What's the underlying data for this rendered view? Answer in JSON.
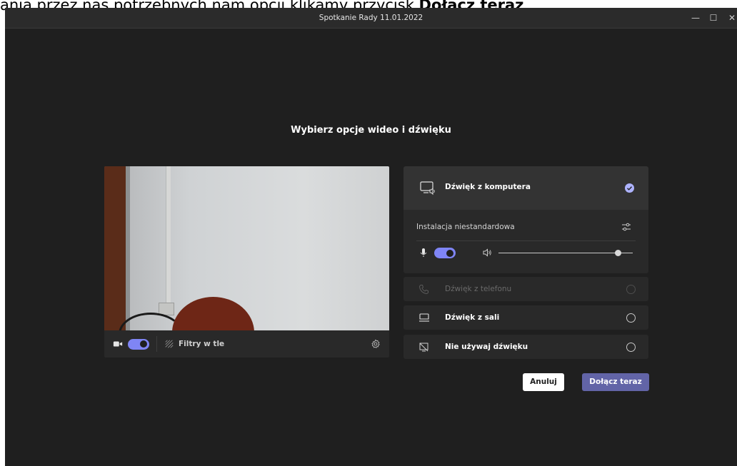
{
  "caption": {
    "text_before": "ania przez nas potrzebnych nam opcji klikamy przycisk ",
    "text_bold": "Dołącz teraz",
    "text_after": "."
  },
  "window": {
    "title": "Spotkanie Rady 11.01.2022",
    "controls": {
      "minimize": "—",
      "maximize": "☐",
      "close": "✕"
    }
  },
  "heading": "Wybierz opcje wideo i dźwięku",
  "video": {
    "camera_toggle_on": true,
    "filters_label": "Filtry w tle"
  },
  "audio": {
    "selected": {
      "label": "Dźwięk z komputera",
      "custom_setup_label": "Instalacja niestandardowa",
      "mic_on": true,
      "speaker_volume": 0.89
    },
    "options": [
      {
        "label": "Dźwięk z telefonu",
        "disabled": true
      },
      {
        "label": "Dźwięk z sali",
        "disabled": false
      },
      {
        "label": "Nie używaj dźwięku",
        "disabled": false
      }
    ]
  },
  "buttons": {
    "cancel": "Anuluj",
    "join": "Dołącz teraz"
  },
  "colors": {
    "accent": "#6264a7",
    "toggle": "#7f85f5",
    "background": "#1f1f1f"
  }
}
